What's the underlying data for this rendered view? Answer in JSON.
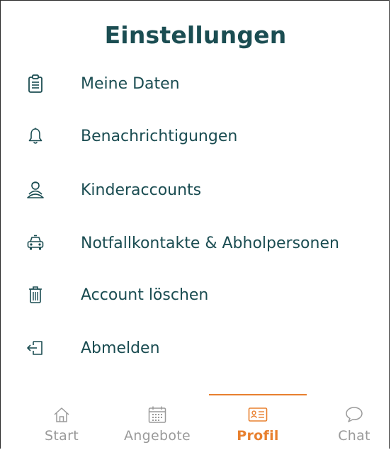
{
  "header": {
    "title": "Einstellungen"
  },
  "menu": {
    "items": [
      {
        "label": "Meine Daten",
        "icon": "clipboard-icon"
      },
      {
        "label": "Benachrichtigungen",
        "icon": "bell-icon"
      },
      {
        "label": "Kinderaccounts",
        "icon": "users-icon"
      },
      {
        "label": "Notfallkontakte & Abholpersonen",
        "icon": "car-icon"
      },
      {
        "label": "Account löschen",
        "icon": "trash-icon"
      },
      {
        "label": "Abmelden",
        "icon": "logout-icon"
      }
    ]
  },
  "tabbar": {
    "tabs": [
      {
        "label": "Start",
        "icon": "home-icon",
        "active": false
      },
      {
        "label": "Angebote",
        "icon": "calendar-icon",
        "active": false
      },
      {
        "label": "Profil",
        "icon": "id-card-icon",
        "active": true
      },
      {
        "label": "Chat",
        "icon": "chat-bubble-icon",
        "active": false
      }
    ]
  },
  "colors": {
    "primary": "#1b4d52",
    "accent": "#e8802f",
    "inactive": "#9a9a9a",
    "background": "#ffffff"
  }
}
